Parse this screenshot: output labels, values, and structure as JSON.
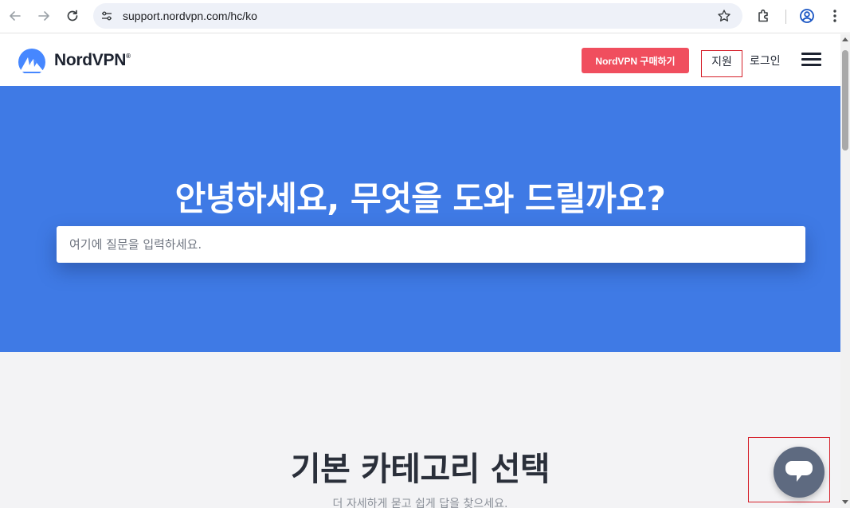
{
  "browser": {
    "url": "support.nordvpn.com/hc/ko",
    "icons": [
      "back-arrow-icon",
      "forward-arrow-icon",
      "reload-icon",
      "site-settings-icon",
      "bookmark-star-icon",
      "extensions-icon",
      "profile-icon",
      "more-menu-icon"
    ]
  },
  "header": {
    "logo_text": "NordVPN",
    "logo_mark": "®",
    "buy_label": "NordVPN 구매하기",
    "support_label": "지원",
    "login_label": "로그인",
    "menu_icon": "hamburger-icon"
  },
  "hero": {
    "title": "안녕하세요, 무엇을 도와 드릴까요?",
    "search_placeholder": "여기에 질문을 입력하세요."
  },
  "categories": {
    "title": "기본 카테고리 선택",
    "subtitle": "더 자세하게 묻고 쉽게 답을 찾으세요."
  },
  "chat": {
    "icon": "chat-bubble-icon"
  },
  "colors": {
    "hero_bg": "#3f7ae5",
    "buy_button": "#f04e5e",
    "highlight": "#d51f2a",
    "chat_button": "#5e6a80",
    "section_bg": "#f3f3f5"
  }
}
